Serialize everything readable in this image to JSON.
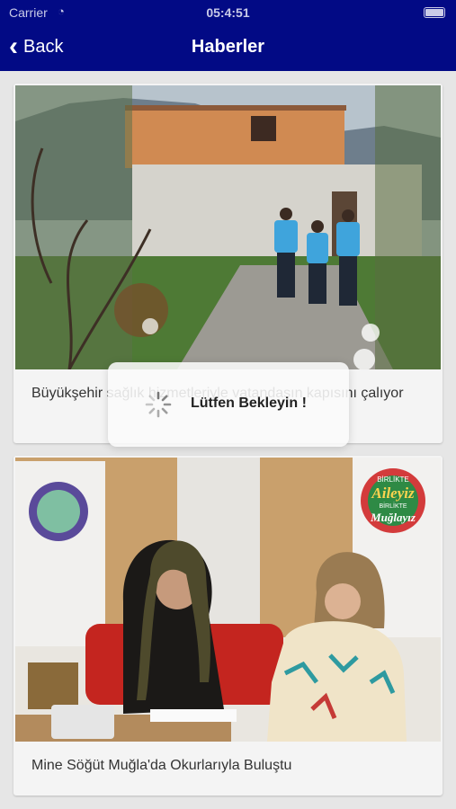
{
  "status_bar": {
    "carrier": "Carrier",
    "time": "05:4:51"
  },
  "nav": {
    "back_label": "Back",
    "title": "Haberler"
  },
  "news": [
    {
      "caption": "Büyükşehir sağlık hizmetleriyle vatandaşın kapısını çalıyor"
    },
    {
      "caption": "Mine Söğüt Muğla'da Okurlarıyla Buluştu"
    }
  ],
  "banners": {
    "line1": "BİRLİKTE",
    "line2": "Aileyiz",
    "line3": "BİRLİKTE",
    "line4": "Muğlayız"
  },
  "loading": {
    "message": "Lütfen Bekleyin !"
  }
}
